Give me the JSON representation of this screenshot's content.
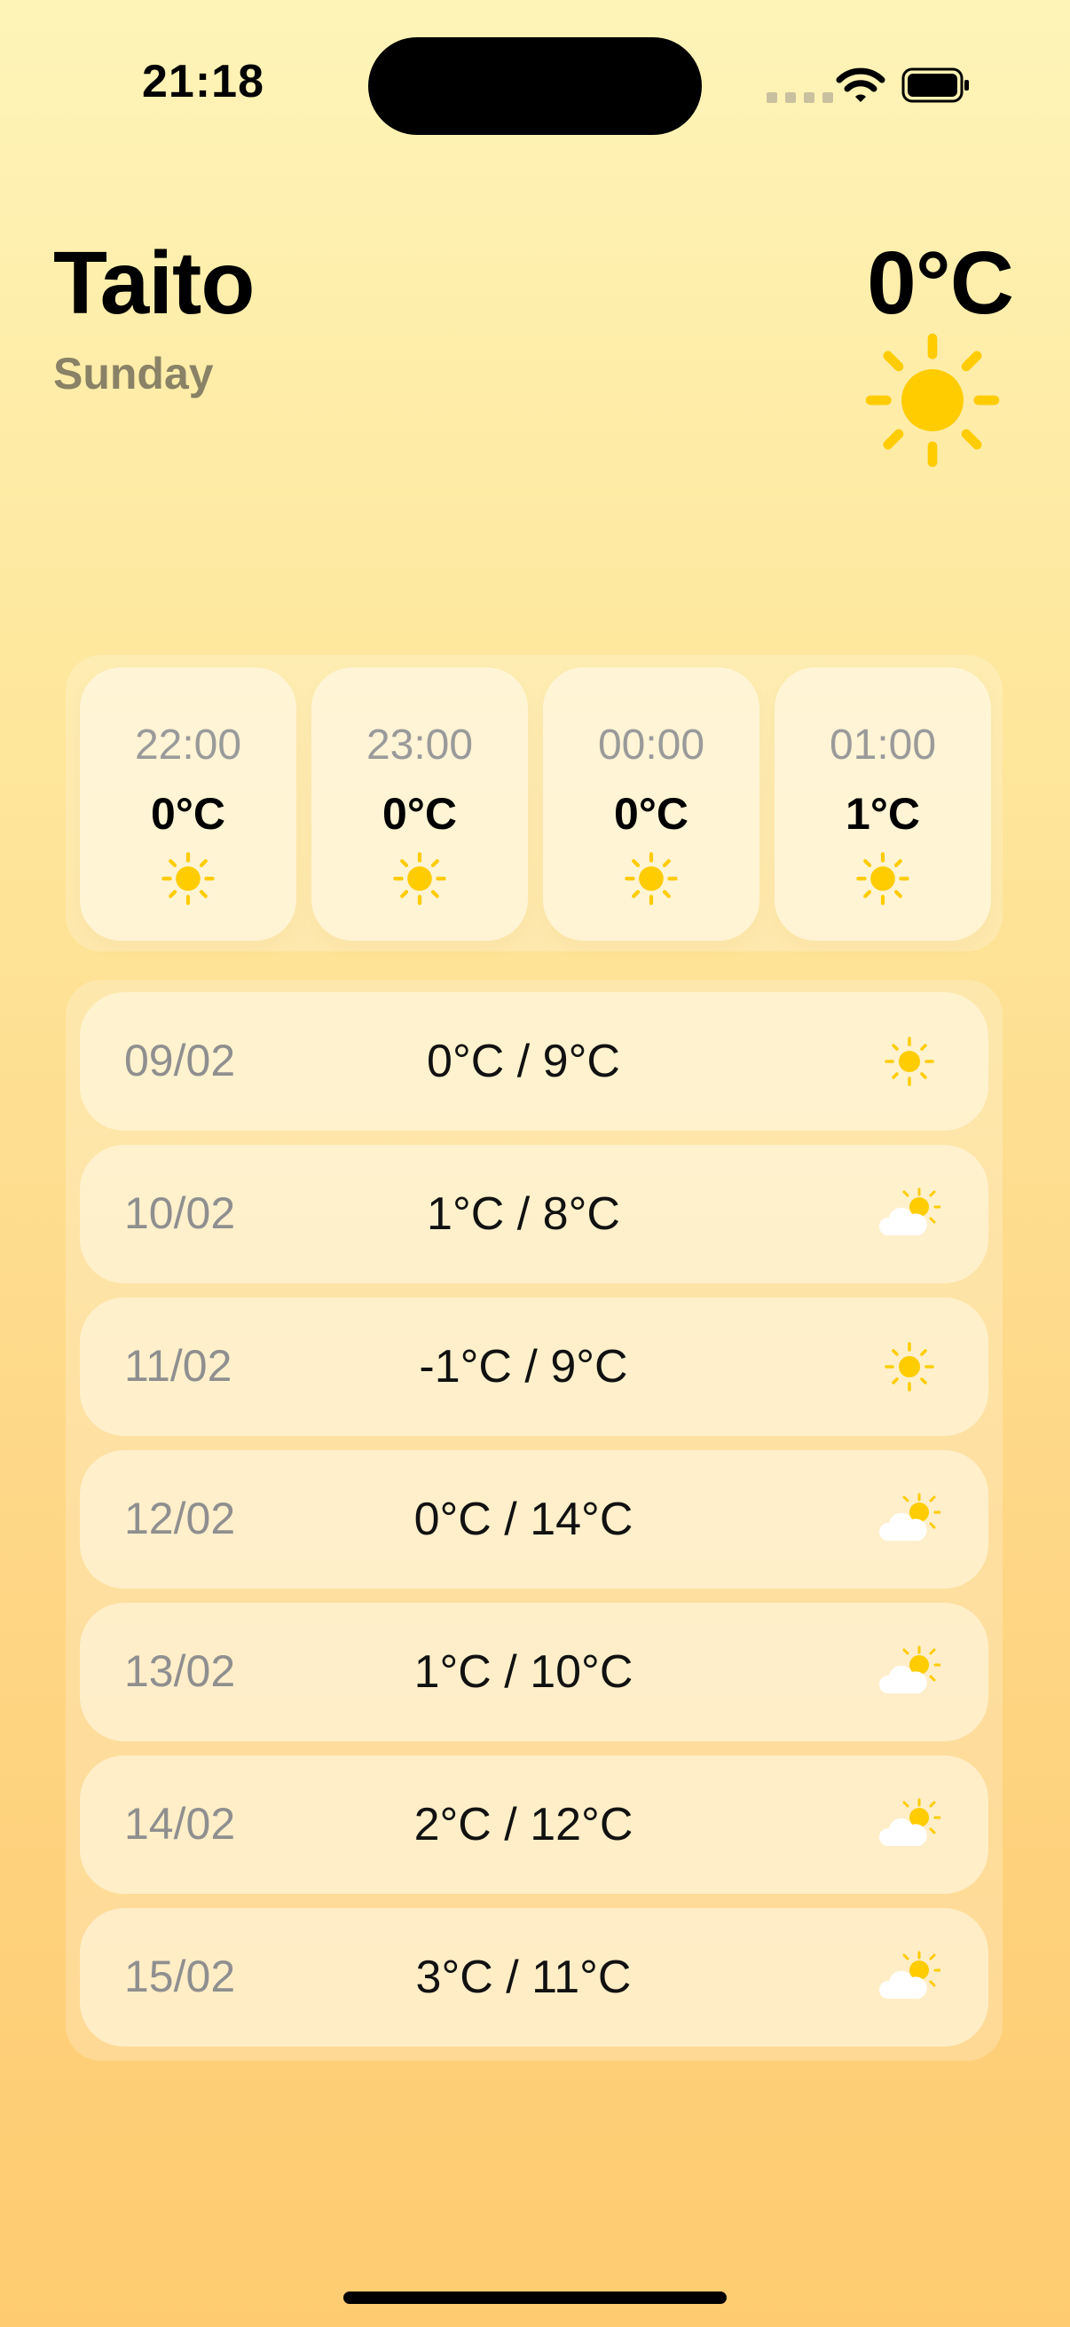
{
  "status_bar": {
    "time": "21:18"
  },
  "header": {
    "city": "Taito",
    "day": "Sunday",
    "current_temp": "0°C",
    "current_icon": "sun-icon"
  },
  "hourly": [
    {
      "time": "22:00",
      "temp": "0°C",
      "icon": "sun-icon"
    },
    {
      "time": "23:00",
      "temp": "0°C",
      "icon": "sun-icon"
    },
    {
      "time": "00:00",
      "temp": "0°C",
      "icon": "sun-icon"
    },
    {
      "time": "01:00",
      "temp": "1°C",
      "icon": "sun-icon"
    }
  ],
  "daily": [
    {
      "date": "09/02",
      "range": "0°C / 9°C",
      "icon": "sun-icon"
    },
    {
      "date": "10/02",
      "range": "1°C / 8°C",
      "icon": "partly-cloudy-icon"
    },
    {
      "date": "11/02",
      "range": "-1°C / 9°C",
      "icon": "sun-icon"
    },
    {
      "date": "12/02",
      "range": "0°C / 14°C",
      "icon": "partly-cloudy-icon"
    },
    {
      "date": "13/02",
      "range": "1°C / 10°C",
      "icon": "partly-cloudy-icon"
    },
    {
      "date": "14/02",
      "range": "2°C / 12°C",
      "icon": "partly-cloudy-icon"
    },
    {
      "date": "15/02",
      "range": "3°C / 11°C",
      "icon": "partly-cloudy-icon"
    }
  ],
  "colors": {
    "sun": "#FFCC00",
    "cloud": "#FFFFFF",
    "background_top": "#FEF4B8",
    "background_bottom": "#FECB70"
  }
}
